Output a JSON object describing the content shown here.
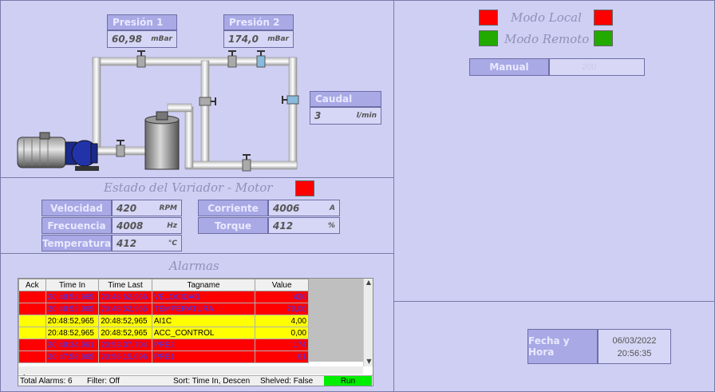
{
  "pressure1": {
    "label": "Presión 1",
    "value": "60,98",
    "unit": "mBar"
  },
  "pressure2": {
    "label": "Presión 2",
    "value": "174,0",
    "unit": "mBar"
  },
  "flow": {
    "label": "Caudal",
    "value": "3",
    "unit": "l/min"
  },
  "variador": {
    "title": "Estado del Variador - Motor"
  },
  "velocidad": {
    "label": "Velocidad",
    "value": "420",
    "unit": "RPM"
  },
  "frecuencia": {
    "label": "Frecuencia",
    "value": "4008",
    "unit": "Hz"
  },
  "temperatura": {
    "label": "Temperatura",
    "value": "412",
    "unit": "°C"
  },
  "corriente": {
    "label": "Corriente",
    "value": "4006",
    "unit": "A"
  },
  "torque": {
    "label": "Torque",
    "value": "412",
    "unit": "%"
  },
  "mode": {
    "local": "Modo Local",
    "remote": "Modo Remoto"
  },
  "manual": {
    "label": "Manual",
    "value": "200"
  },
  "datetime": {
    "label": "Fecha y Hora",
    "date": "06/03/2022",
    "time": "20:56:35"
  },
  "alarms": {
    "title": "Alarmas",
    "headers": [
      "Ack",
      "Time In",
      "Time Last",
      "Tagname",
      "Value"
    ],
    "rows": [
      {
        "ack": "",
        "time_in": "20:48:52,965",
        "time_last": "20:48:52,965",
        "tag": "VELOCIDAD",
        "value": "420"
      },
      {
        "ack": "",
        "time_in": "20:48:52,965",
        "time_last": "20:48:52,965",
        "tag": "TEMPERATURA",
        "value": "78,00"
      },
      {
        "ack": "",
        "time_in": "20:48:52,965",
        "time_last": "20:48:52,965",
        "tag": "AI1C",
        "value": "4,00"
      },
      {
        "ack": "",
        "time_in": "20:48:52,965",
        "time_last": "20:48:52,965",
        "tag": "ACC_CONTROL",
        "value": "0,00"
      },
      {
        "ack": "",
        "time_in": "20:48:34,961",
        "time_last": "20:53:37,704",
        "tag": "PRE2",
        "value": "174"
      },
      {
        "ack": "",
        "time_in": "20:47:58,965",
        "time_last": "20:56:15,696",
        "tag": "PRE1",
        "value": "61"
      }
    ],
    "status": {
      "total": "Total Alarms: 6",
      "filter": "Filter: Off",
      "sort": "Sort: Time In, Descen",
      "shelved": "Shelved: False",
      "run": "Run"
    }
  },
  "colors": {
    "active_red": "#ff0000",
    "active_green": "#22aa00",
    "row_red": "#ff0000",
    "row_yellow": "#ffff00"
  }
}
